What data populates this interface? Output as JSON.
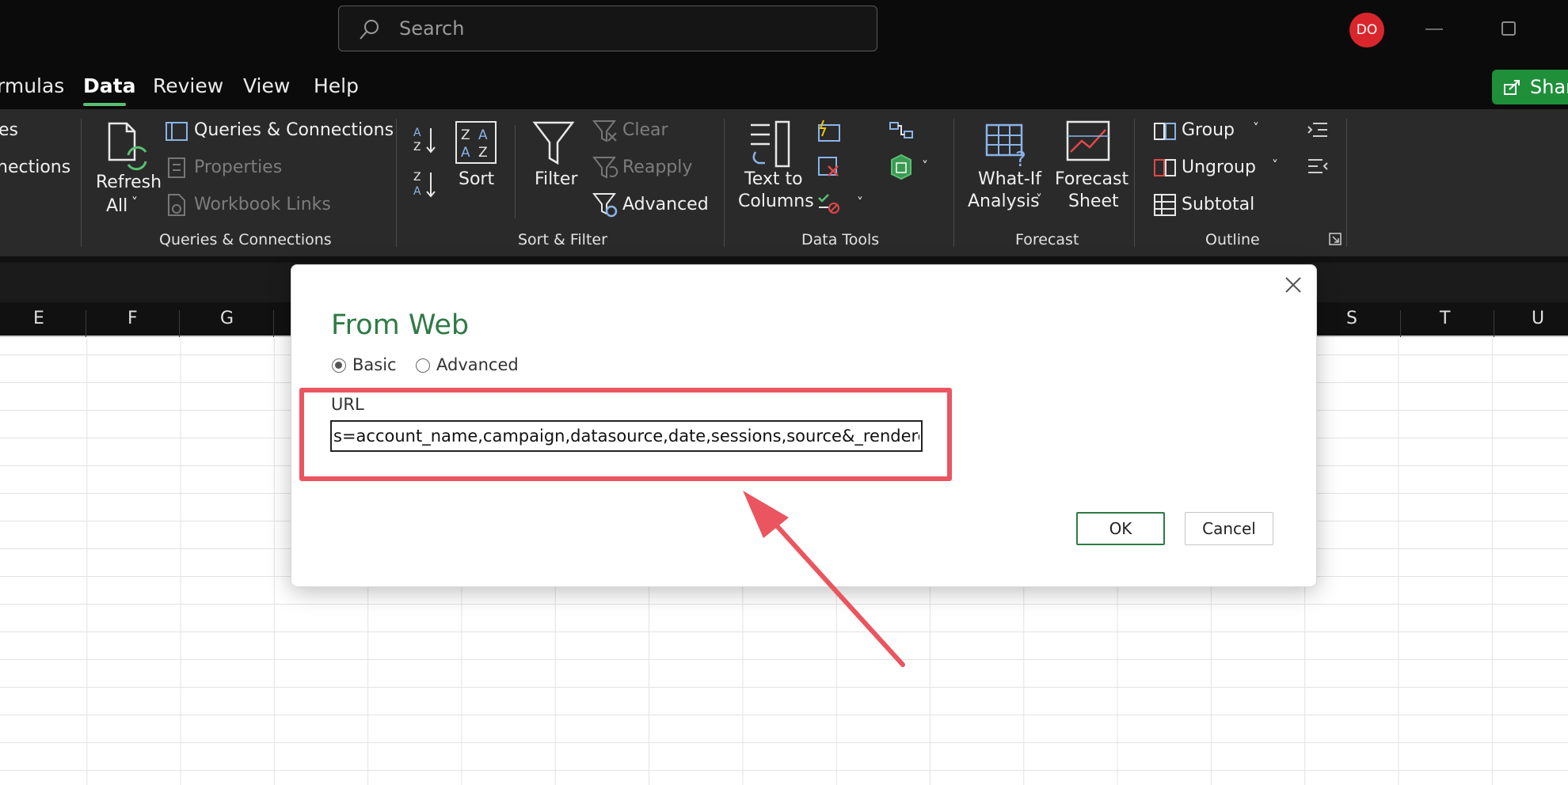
{
  "window": {
    "search_placeholder": "Search",
    "user_initials": "DO"
  },
  "tabs": [
    {
      "label": "rmulas"
    },
    {
      "label": "Data",
      "active": true
    },
    {
      "label": "Review"
    },
    {
      "label": "View"
    },
    {
      "label": "Help"
    }
  ],
  "share_label": "Share",
  "ribbon": {
    "get_data": {
      "item_1": "es",
      "item_2": "nections"
    },
    "queries": {
      "refresh_line1": "Refresh",
      "refresh_line2": "All",
      "queries_connections": "Queries & Connections",
      "properties": "Properties",
      "workbook_links": "Workbook Links",
      "group_label": "Queries & Connections"
    },
    "sort_filter": {
      "sort": "Sort",
      "filter": "Filter",
      "clear": "Clear",
      "reapply": "Reapply",
      "advanced": "Advanced",
      "group_label": "Sort & Filter"
    },
    "data_tools": {
      "text_to_columns_line1": "Text to",
      "text_to_columns_line2": "Columns",
      "group_label": "Data Tools"
    },
    "forecast": {
      "what_if_line1": "What-If",
      "what_if_line2": "Analysis",
      "forecast_sheet_line1": "Forecast",
      "forecast_sheet_line2": "Sheet",
      "group_label": "Forecast"
    },
    "outline": {
      "group": "Group",
      "ungroup": "Ungroup",
      "subtotal": "Subtotal",
      "group_label": "Outline"
    }
  },
  "columns": [
    "E",
    "F",
    "G",
    "S",
    "T",
    "U"
  ],
  "dialog": {
    "title": "From Web",
    "mode_basic": "Basic",
    "mode_advanced": "Advanced",
    "selected_mode": "Basic",
    "url_label": "URL",
    "url_value": "s=account_name,campaign,datasource,date,sessions,source&_renderer=csv",
    "ok": "OK",
    "cancel": "Cancel"
  },
  "colors": {
    "accent_green": "#2f7a46",
    "highlight_red": "#ea5560",
    "avatar_red": "#d9262c",
    "ribbon_bg": "#2a2a2a"
  }
}
